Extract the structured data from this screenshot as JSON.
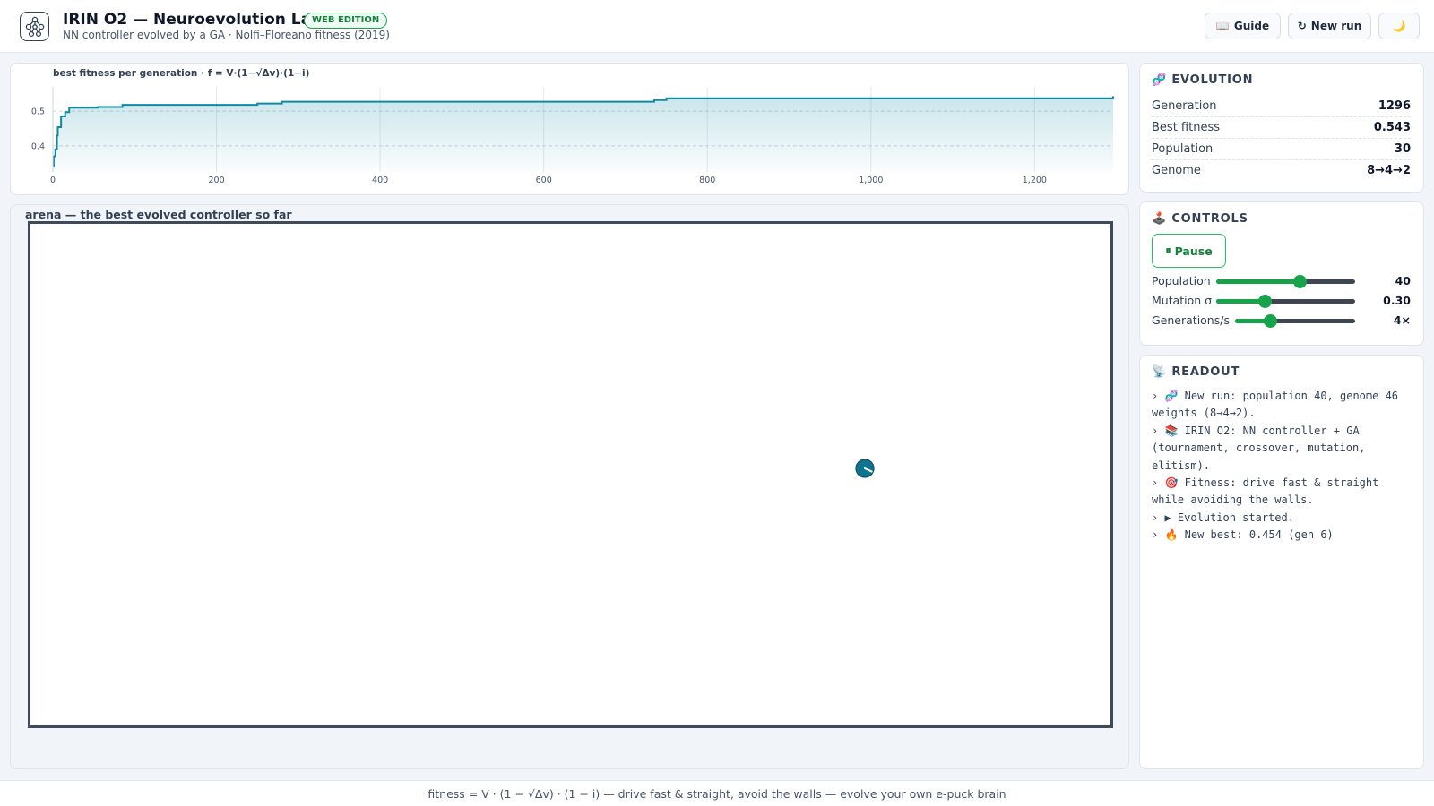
{
  "header": {
    "title": "IRIN O2 — Neuroevolution Lab",
    "badge": "WEB EDITION",
    "subtitle": "NN controller evolved by a GA · Nolfi–Floreano fitness (2019)",
    "guide_icon": "📖",
    "guide_label": "Guide",
    "new_run_icon": "↻",
    "new_run_label": "New run",
    "theme_icon": "🌙",
    "logo_icon": "neural-network-icon"
  },
  "chart": {
    "title": "best fitness per generation · f = V·(1−√Δv)·(1−i)"
  },
  "chart_data": {
    "type": "area",
    "title": "best fitness per generation · f = V·(1−√Δv)·(1−i)",
    "xlabel": "",
    "ylabel": "",
    "xlim": [
      0,
      1296
    ],
    "ylim": [
      0.325,
      0.57
    ],
    "x_ticks": [
      0,
      200,
      400,
      600,
      800,
      1000,
      1200
    ],
    "x_tick_labels": [
      "0",
      "200",
      "400",
      "600",
      "800",
      "1,000",
      "1,200"
    ],
    "y_ticks": [
      0.4,
      0.5
    ],
    "y_tick_labels": [
      "0.4",
      "0.5"
    ],
    "grid": true,
    "legend": "none",
    "color": "#0e8aa3",
    "series": [
      {
        "x": [
          0,
          1,
          3,
          5,
          6,
          10,
          15,
          20,
          55,
          85,
          250,
          280,
          735,
          750,
          1296
        ],
        "values": [
          0.34,
          0.37,
          0.39,
          0.43,
          0.454,
          0.485,
          0.497,
          0.51,
          0.512,
          0.518,
          0.522,
          0.527,
          0.532,
          0.537,
          0.543
        ]
      }
    ]
  },
  "arena": {
    "label": "arena — the best evolved controller so far",
    "robot_heading_deg": 25
  },
  "evolution": {
    "icon": "🧬",
    "heading": "EVOLUTION",
    "stats": [
      {
        "label": "Generation",
        "value": "1296"
      },
      {
        "label": "Best fitness",
        "value": "0.543"
      },
      {
        "label": "Population",
        "value": "30"
      },
      {
        "label": "Genome",
        "value": "8→4→2"
      }
    ]
  },
  "controls": {
    "icon": "🕹️",
    "heading": "CONTROLS",
    "pause_icon": "⏸",
    "pause_label": "Pause",
    "sliders": [
      {
        "label": "Population",
        "value": "40",
        "fraction": 0.6
      },
      {
        "label": "Mutation σ",
        "value": "0.30",
        "fraction": 0.35
      },
      {
        "label": "Generations/s",
        "value": "4×",
        "fraction": 0.29
      }
    ]
  },
  "readout": {
    "icon": "📡",
    "heading": "READOUT",
    "lines": [
      "› 🧬 New run: population 40, genome 46 weights (8→4→2).",
      "› 📚 IRIN O2: NN controller + GA (tournament, crossover, mutation, elitism).",
      "› 🎯 Fitness: drive fast & straight while avoiding the walls.",
      "› ▶ Evolution started.",
      "› 🔥 New best: 0.454 (gen 6)"
    ]
  },
  "footer": {
    "text": "fitness = V · (1 − √Δv) · (1 − i) — drive fast & straight, avoid the walls — evolve your own e-puck brain"
  }
}
